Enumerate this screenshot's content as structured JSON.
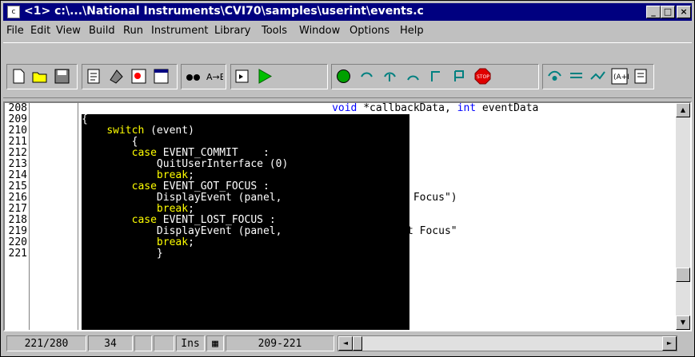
{
  "window": {
    "title": "<1> c:\\...\\National Instruments\\CVI70\\samples\\userint\\events.c",
    "app_icon": "document-c-icon",
    "buttons": {
      "minimize": "_",
      "maximize": "□",
      "close": "×"
    }
  },
  "menu": [
    {
      "label": "File"
    },
    {
      "label": "Edit"
    },
    {
      "label": "View"
    },
    {
      "label": "Build"
    },
    {
      "label": "Run"
    },
    {
      "label": "Instrument"
    },
    {
      "label": "Library"
    },
    {
      "label": "Tools"
    },
    {
      "label": "Window"
    },
    {
      "label": "Options"
    },
    {
      "label": "Help"
    }
  ],
  "toolbar": {
    "icons": [
      "new-file-icon",
      "open-folder-icon",
      "save-icon",
      "edit-icon",
      "build-icon",
      "find-icon",
      "window-icon",
      "binoculars-icon",
      "replace-icon",
      "step-icon",
      "run-icon",
      "step-into-icon",
      "step-over-icon",
      "step-return-icon",
      "step-out-icon",
      "go-to-cursor-icon",
      "stop-icon",
      "watch-icon",
      "variables-icon",
      "tracepoint-icon",
      "function-panel-icon",
      "page-icon"
    ]
  },
  "editor": {
    "line_numbers": [
      "208",
      "209",
      "210",
      "211",
      "212",
      "213",
      "214",
      "215",
      "216",
      "217",
      "218",
      "219",
      "220",
      "221"
    ],
    "lines": [
      {
        "indent": "                                        ",
        "parts": [
          [
            "kw",
            "void"
          ],
          [
            "plain",
            " *callbackData, "
          ],
          [
            "kw",
            "int"
          ],
          [
            "plain",
            " eventData"
          ]
        ]
      },
      {
        "indent": "",
        "parts": [
          [
            "sw",
            "{"
          ]
        ]
      },
      {
        "indent": "    ",
        "parts": [
          [
            "sk",
            "switch"
          ],
          [
            "sw",
            " (event)"
          ]
        ]
      },
      {
        "indent": "        ",
        "parts": [
          [
            "sw",
            "{"
          ]
        ]
      },
      {
        "indent": "        ",
        "parts": [
          [
            "sk",
            "case"
          ],
          [
            "sw",
            " EVENT_COMMIT    :"
          ]
        ]
      },
      {
        "indent": "            ",
        "parts": [
          [
            "sw",
            "QuitUserInterface (0)"
          ],
          [
            "plain",
            ";"
          ]
        ]
      },
      {
        "indent": "            ",
        "parts": [
          [
            "sk",
            "break"
          ],
          [
            "sw",
            ";"
          ]
        ]
      },
      {
        "indent": "        ",
        "parts": [
          [
            "sk",
            "case"
          ],
          [
            "sw",
            " EVENT_GOT_FOCUS :"
          ]
        ]
      },
      {
        "indent": "            ",
        "parts": [
          [
            "sw",
            "DisplayEvent (panel, "
          ],
          [
            "plain",
            "\"Quit Button\", \"Got Focus\")"
          ]
        ]
      },
      {
        "indent": "            ",
        "parts": [
          [
            "sk",
            "break"
          ],
          [
            "sw",
            ";"
          ]
        ]
      },
      {
        "indent": "        ",
        "parts": [
          [
            "sk",
            "case"
          ],
          [
            "sw",
            " EVENT_LOST_FOCUS :"
          ]
        ]
      },
      {
        "indent": "            ",
        "parts": [
          [
            "sw",
            "DisplayEvent (panel, "
          ],
          [
            "plain",
            "\"Quit Button\", \"Lost Focus\""
          ]
        ]
      },
      {
        "indent": "            ",
        "parts": [
          [
            "sk",
            "break"
          ],
          [
            "sw",
            ";"
          ]
        ]
      },
      {
        "indent": "            ",
        "parts": [
          [
            "sw",
            "}"
          ]
        ]
      }
    ]
  },
  "status": {
    "line_position": "221/280",
    "column": "34",
    "insert_mode": "Ins",
    "selection_range": "209-221"
  },
  "colors": {
    "keyword": "#0000ff",
    "selected_keyword": "#ffff00",
    "title_bar": "#000080"
  }
}
